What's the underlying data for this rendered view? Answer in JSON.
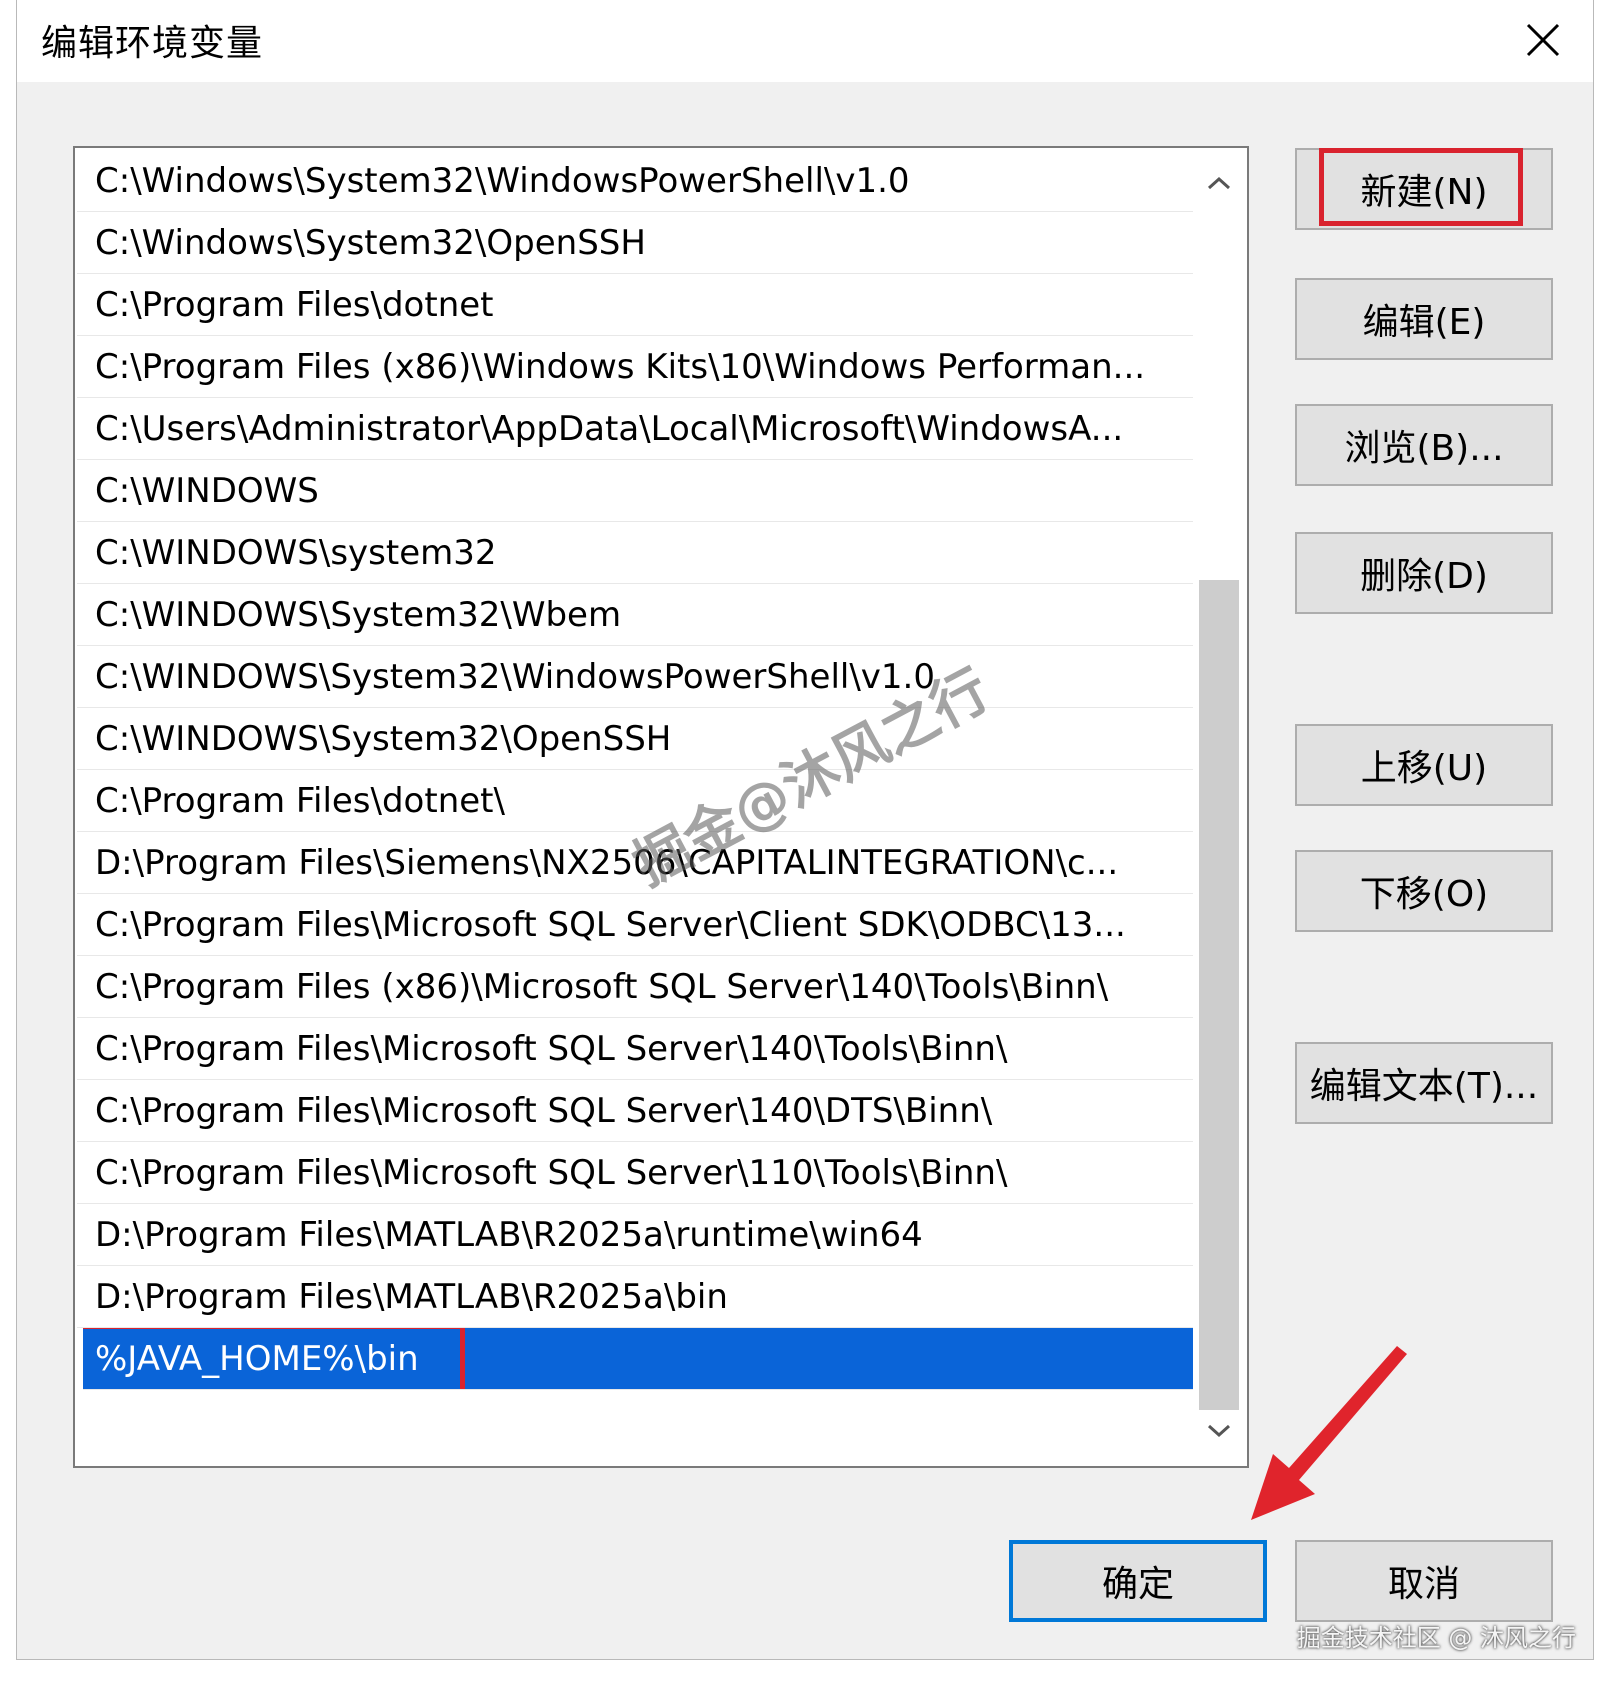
{
  "dialog": {
    "title": "编辑环境变量"
  },
  "path_list": {
    "items": [
      "C:\\Windows\\System32\\WindowsPowerShell\\v1.0",
      "C:\\Windows\\System32\\OpenSSH",
      "C:\\Program Files\\dotnet",
      "C:\\Program Files (x86)\\Windows Kits\\10\\Windows Performan...",
      "C:\\Users\\Administrator\\AppData\\Local\\Microsoft\\WindowsA...",
      "C:\\WINDOWS",
      "C:\\WINDOWS\\system32",
      "C:\\WINDOWS\\System32\\Wbem",
      "C:\\WINDOWS\\System32\\WindowsPowerShell\\v1.0",
      "C:\\WINDOWS\\System32\\OpenSSH",
      "C:\\Program Files\\dotnet\\",
      "D:\\Program Files\\Siemens\\NX2506\\CAPITALINTEGRATION\\c...",
      "C:\\Program Files\\Microsoft SQL Server\\Client SDK\\ODBC\\13...",
      "C:\\Program Files (x86)\\Microsoft SQL Server\\140\\Tools\\Binn\\",
      "C:\\Program Files\\Microsoft SQL Server\\140\\Tools\\Binn\\",
      "C:\\Program Files\\Microsoft SQL Server\\140\\DTS\\Binn\\",
      "C:\\Program Files\\Microsoft SQL Server\\110\\Tools\\Binn\\",
      "D:\\Program Files\\MATLAB\\R2025a\\runtime\\win64",
      "D:\\Program Files\\MATLAB\\R2025a\\bin"
    ],
    "selected_item": "%JAVA_HOME%\\bin"
  },
  "buttons": {
    "new": "新建(N)",
    "edit": "编辑(E)",
    "browse": "浏览(B)...",
    "delete": "删除(D)",
    "move_up": "上移(U)",
    "move_down": "下移(O)",
    "edit_text": "编辑文本(T)...",
    "ok": "确定",
    "cancel": "取消"
  },
  "watermarks": {
    "center": "掘金@沐风之行",
    "footer": "掘金技术社区 @ 沐风之行"
  },
  "colors": {
    "selection": "#0a64d8",
    "highlight_box": "#d9232e",
    "arrow": "#e0242c",
    "default_button_border": "#0078d7"
  }
}
